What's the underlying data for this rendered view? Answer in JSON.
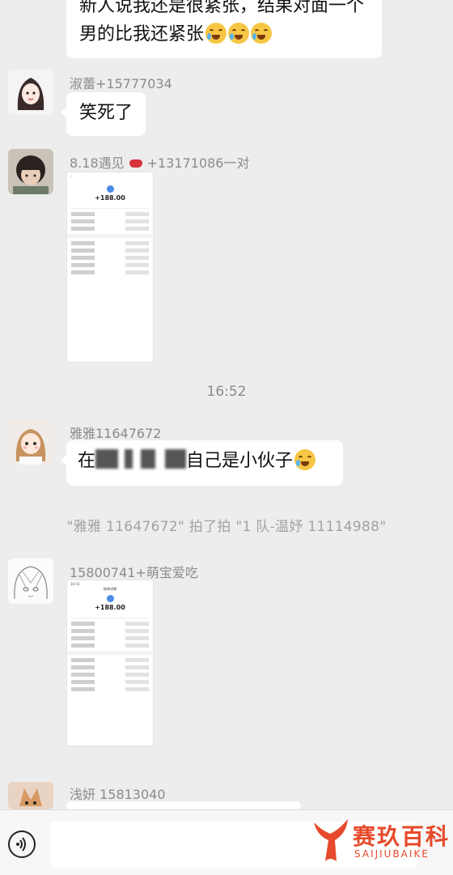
{
  "messages": [
    {
      "type": "text",
      "sender": "",
      "text_line1": "新人说我还是很紧张，结果对面一个",
      "text_line2": "男的比我还紧张"
    },
    {
      "type": "text",
      "sender": "淑蕾+15777034",
      "text": "笑死了"
    },
    {
      "type": "image",
      "sender_prefix": "8.18遇见",
      "sender_suffix": "+13171086一对",
      "receipt": {
        "amount": "+188.00"
      }
    },
    {
      "type": "time",
      "text": "16:52"
    },
    {
      "type": "text",
      "sender": "雅雅11647672",
      "text_visible_start": "在",
      "text_visible_mid": "自己是小伙子"
    },
    {
      "type": "system",
      "text": "\"雅雅 11647672\"  拍了拍  \"1 队-温妤 11114988\""
    },
    {
      "type": "image",
      "sender": "15800741+萌宝爱吃",
      "receipt": {
        "title": "账单详情",
        "amount": "+188.00",
        "time": "10:53"
      }
    },
    {
      "type": "text",
      "sender": "浅妍  15813040"
    }
  ],
  "watermark": {
    "name": "赛玖百科",
    "sub": "SAIJIUBAIKE",
    "color": "#e6492b"
  },
  "icons": {
    "voice": "voice-icon",
    "lips": "lips-emoji-icon",
    "laugh": "laugh-cry-emoji-icon"
  }
}
